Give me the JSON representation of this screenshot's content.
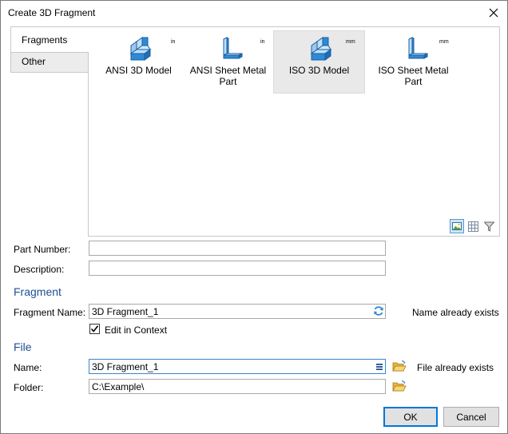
{
  "window": {
    "title": "Create 3D Fragment"
  },
  "tabs": [
    {
      "label": "Fragments",
      "active": true
    },
    {
      "label": "Other",
      "active": false
    }
  ],
  "gallery": {
    "items": [
      {
        "label": "ANSI 3D Model",
        "unit": "in",
        "icon": "solid-block-icon",
        "selected": false
      },
      {
        "label": "ANSI Sheet Metal Part",
        "unit": "in",
        "icon": "sheet-metal-icon",
        "selected": false
      },
      {
        "label": "ISO 3D Model",
        "unit": "mm",
        "icon": "solid-block-icon",
        "selected": true
      },
      {
        "label": "ISO Sheet Metal Part",
        "unit": "mm",
        "icon": "sheet-metal-icon",
        "selected": false
      }
    ],
    "view_buttons": [
      "image-view-icon",
      "grid-view-icon",
      "filter-icon"
    ]
  },
  "fields": {
    "part_number": {
      "label": "Part Number:",
      "value": ""
    },
    "description": {
      "label": "Description:",
      "value": ""
    }
  },
  "fragment_section": {
    "heading": "Fragment",
    "name_label": "Fragment Name:",
    "name_value": "3D Fragment_1",
    "status": "Name already exists",
    "edit_in_context_label": "Edit in Context",
    "edit_in_context_checked": true
  },
  "file_section": {
    "heading": "File",
    "name_label": "Name:",
    "name_value": "3D Fragment_1",
    "name_status": "File already exists",
    "folder_label": "Folder:",
    "folder_value": "C:\\Example\\"
  },
  "buttons": {
    "ok": "OK",
    "cancel": "Cancel"
  },
  "colors": {
    "section_heading": "#1f4f96",
    "icon_blue": "#2e8ad8",
    "focus_border": "#3e82d1"
  }
}
